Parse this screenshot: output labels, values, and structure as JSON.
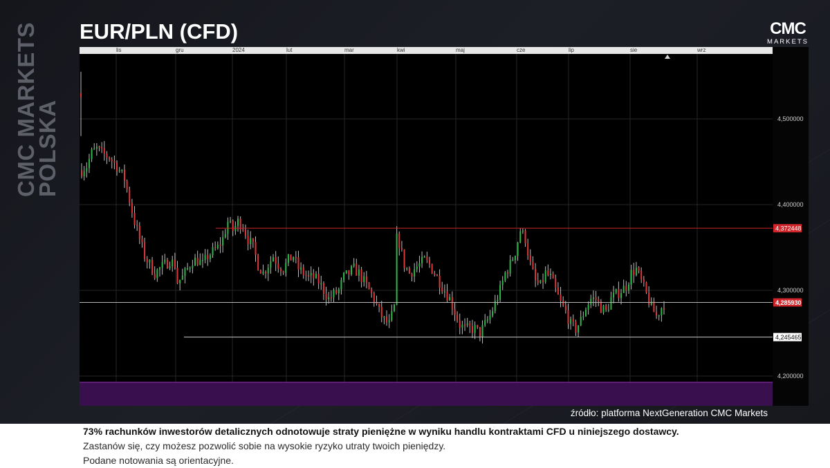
{
  "brand_vertical": [
    "CMC MARKETS",
    "POLSKA"
  ],
  "title": "EUR/PLN (CFD)",
  "logo": {
    "mark": "CMC",
    "sub": "MARKETS"
  },
  "source": "źródło: platforma NextGeneration CMC Markets",
  "disclaimer": {
    "line1": "73% rachunków inwestorów detalicznych odnotowuje straty pieniężne w wyniku handlu kontraktami CFD u niniejszego dostawcy.",
    "line2": "Zastanów się, czy możesz pozwolić sobie na wysokie ryzyko utraty twoich pieniędzy.",
    "line3": "Podane notowania są orientacyjne."
  },
  "colors": {
    "up": "#2eb94a",
    "down": "#e0373b",
    "neutral": "#bfbfbf",
    "resistance": "#d0262b",
    "purple_band": "#3a0f4e"
  },
  "chart_data": {
    "type": "ohlc",
    "x_axis": {
      "ticks": [
        "lis",
        "gru",
        "2024",
        "lut",
        "mar",
        "kwi",
        "maj",
        "cze",
        "lip",
        "sie",
        "wrz"
      ]
    },
    "y_axis": {
      "ticks": [
        "4,500000",
        "4,400000",
        "4,300000",
        "4,200000"
      ],
      "tick_values": [
        4.5,
        4.4,
        4.3,
        4.2
      ],
      "ylim": [
        4.165,
        4.58
      ]
    },
    "levels": [
      {
        "name": "resistance",
        "value": 4.372448,
        "label": "4,372448"
      },
      {
        "name": "last",
        "value": 4.28593,
        "label": "4,285930"
      },
      {
        "name": "support",
        "value": 4.245465,
        "label": "4,245465"
      }
    ],
    "waypoints": [
      [
        0,
        4.44
      ],
      [
        2,
        4.445
      ],
      [
        4,
        4.46
      ],
      [
        6,
        4.465
      ],
      [
        8,
        4.46
      ],
      [
        11,
        4.455
      ],
      [
        14,
        4.445
      ],
      [
        17,
        4.43
      ],
      [
        19,
        4.405
      ],
      [
        21,
        4.38
      ],
      [
        23,
        4.36
      ],
      [
        25,
        4.34
      ],
      [
        27,
        4.33
      ],
      [
        29,
        4.32
      ],
      [
        31,
        4.325
      ],
      [
        33,
        4.33
      ],
      [
        35,
        4.335
      ],
      [
        37,
        4.33
      ],
      [
        38,
        4.31
      ],
      [
        40,
        4.315
      ],
      [
        42,
        4.325
      ],
      [
        44,
        4.335
      ],
      [
        46,
        4.335
      ],
      [
        48,
        4.33
      ],
      [
        50,
        4.34
      ],
      [
        52,
        4.345
      ],
      [
        54,
        4.35
      ],
      [
        56,
        4.36
      ],
      [
        58,
        4.38
      ],
      [
        60,
        4.37
      ],
      [
        62,
        4.38
      ],
      [
        64,
        4.375
      ],
      [
        66,
        4.36
      ],
      [
        68,
        4.35
      ],
      [
        70,
        4.33
      ],
      [
        72,
        4.32
      ],
      [
        74,
        4.33
      ],
      [
        76,
        4.34
      ],
      [
        78,
        4.33
      ],
      [
        80,
        4.325
      ],
      [
        82,
        4.335
      ],
      [
        84,
        4.34
      ],
      [
        86,
        4.325
      ],
      [
        88,
        4.32
      ],
      [
        90,
        4.315
      ],
      [
        92,
        4.315
      ],
      [
        94,
        4.31
      ],
      [
        96,
        4.3
      ],
      [
        98,
        4.29
      ],
      [
        100,
        4.295
      ],
      [
        102,
        4.3
      ],
      [
        104,
        4.315
      ],
      [
        106,
        4.32
      ],
      [
        108,
        4.325
      ],
      [
        110,
        4.32
      ],
      [
        112,
        4.31
      ],
      [
        114,
        4.3
      ],
      [
        116,
        4.29
      ],
      [
        118,
        4.275
      ],
      [
        120,
        4.265
      ],
      [
        122,
        4.26
      ],
      [
        124,
        4.28
      ],
      [
        125,
        4.36
      ],
      [
        126,
        4.355
      ],
      [
        128,
        4.33
      ],
      [
        130,
        4.32
      ],
      [
        132,
        4.325
      ],
      [
        134,
        4.33
      ],
      [
        136,
        4.335
      ],
      [
        138,
        4.33
      ],
      [
        140,
        4.32
      ],
      [
        142,
        4.31
      ],
      [
        144,
        4.3
      ],
      [
        146,
        4.29
      ],
      [
        148,
        4.275
      ],
      [
        150,
        4.26
      ],
      [
        152,
        4.255
      ],
      [
        154,
        4.255
      ],
      [
        156,
        4.255
      ],
      [
        158,
        4.25
      ],
      [
        160,
        4.26
      ],
      [
        162,
        4.27
      ],
      [
        164,
        4.285
      ],
      [
        166,
        4.3
      ],
      [
        168,
        4.32
      ],
      [
        170,
        4.33
      ],
      [
        172,
        4.345
      ],
      [
        174,
        4.37
      ],
      [
        176,
        4.36
      ],
      [
        178,
        4.33
      ],
      [
        180,
        4.31
      ],
      [
        182,
        4.305
      ],
      [
        184,
        4.32
      ],
      [
        186,
        4.315
      ],
      [
        188,
        4.3
      ],
      [
        190,
        4.285
      ],
      [
        192,
        4.275
      ],
      [
        194,
        4.26
      ],
      [
        196,
        4.255
      ],
      [
        198,
        4.265
      ],
      [
        200,
        4.28
      ],
      [
        202,
        4.29
      ],
      [
        204,
        4.29
      ],
      [
        206,
        4.28
      ],
      [
        208,
        4.275
      ],
      [
        210,
        4.29
      ],
      [
        212,
        4.295
      ],
      [
        214,
        4.3
      ],
      [
        216,
        4.305
      ],
      [
        218,
        4.32
      ],
      [
        220,
        4.325
      ],
      [
        222,
        4.31
      ],
      [
        224,
        4.295
      ],
      [
        226,
        4.28
      ],
      [
        228,
        4.27
      ],
      [
        230,
        4.28
      ],
      [
        231,
        4.285
      ]
    ]
  }
}
